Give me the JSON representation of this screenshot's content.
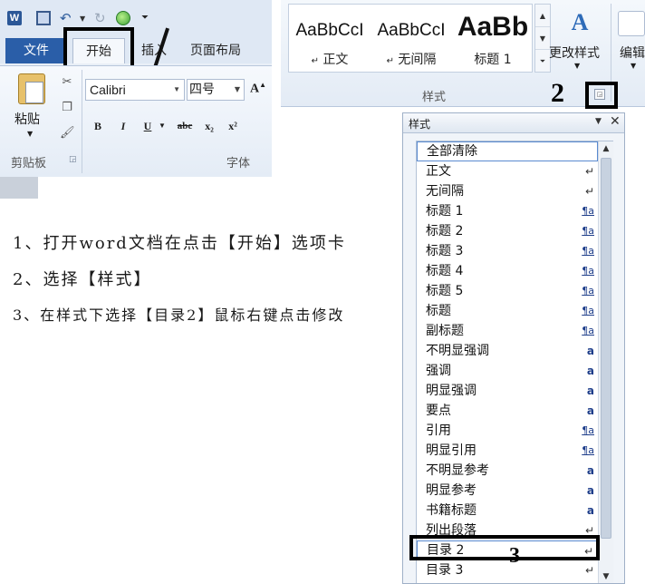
{
  "ribbon": {
    "app_logo": "W",
    "icons": [
      "save-icon",
      "undo-icon",
      "redo-icon",
      "circle-icon",
      "customize-icon"
    ],
    "tabs": {
      "file": "文件",
      "home": "开始",
      "insert": "插入",
      "page_layout": "页面布局"
    },
    "clipboard": {
      "paste_label": "粘贴",
      "group_label": "剪贴板"
    },
    "font": {
      "font_name": "Calibri",
      "font_size": "四号",
      "grow_label": "A",
      "bold": "B",
      "italic": "I",
      "underline": "U",
      "strikethrough": "abc",
      "subscript": "x₂",
      "superscript": "x²",
      "group_label": "字体"
    },
    "styles": {
      "gallery": [
        {
          "sample": "AaBbCcI",
          "name": "正文",
          "sample_size": "19px",
          "weight": "normal"
        },
        {
          "sample": "AaBbCcI",
          "name": "无间隔",
          "sample_size": "19px",
          "weight": "normal"
        },
        {
          "sample": "AaBb",
          "name": "标题 1",
          "sample_size": "30px",
          "weight": "bold"
        }
      ],
      "change_styles_label": "更改样式",
      "edit_label": "编辑",
      "group_label": "样式"
    }
  },
  "annotations": {
    "step_2_mark": "2",
    "step_3_mark": "3"
  },
  "instructions": [
    "1、打开word文档在点击【开始】选项卡",
    "2、选择【样式】",
    "3、在样式下选择【目录2】鼠标右键点击修改"
  ],
  "styles_pane": {
    "title": "样式",
    "items": [
      {
        "label": "全部清除",
        "icon": "",
        "selected": true
      },
      {
        "label": "正文",
        "icon": "↵"
      },
      {
        "label": "无间隔",
        "icon": "↵"
      },
      {
        "label": "标题  1",
        "icon": "¶a"
      },
      {
        "label": "标题  2",
        "icon": "¶a"
      },
      {
        "label": "标题  3",
        "icon": "¶a"
      },
      {
        "label": "标题  4",
        "icon": "¶a"
      },
      {
        "label": "标题  5",
        "icon": "¶a"
      },
      {
        "label": "标题",
        "icon": "¶a"
      },
      {
        "label": "副标题",
        "icon": "¶a"
      },
      {
        "label": "不明显强调",
        "icon": "a"
      },
      {
        "label": "强调",
        "icon": "a"
      },
      {
        "label": "明显强调",
        "icon": "a"
      },
      {
        "label": "要点",
        "icon": "a"
      },
      {
        "label": "引用",
        "icon": "¶a"
      },
      {
        "label": "明显引用",
        "icon": "¶a"
      },
      {
        "label": "不明显参考",
        "icon": "a"
      },
      {
        "label": "明显参考",
        "icon": "a"
      },
      {
        "label": "书籍标题",
        "icon": "a"
      },
      {
        "label": "列出段落",
        "icon": "↵"
      },
      {
        "label": "目录  2",
        "icon": "↵",
        "selected": true
      },
      {
        "label": "目录  3",
        "icon": "↵"
      }
    ]
  }
}
